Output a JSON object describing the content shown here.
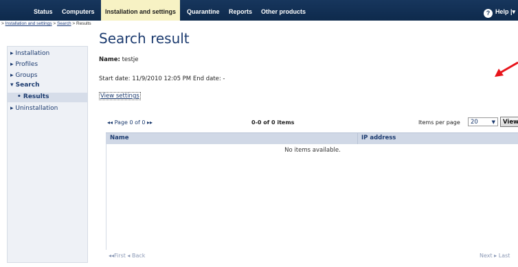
{
  "topnav": {
    "items": [
      {
        "label": "Status"
      },
      {
        "label": "Computers"
      },
      {
        "label": "Installation and settings"
      },
      {
        "label": "Quarantine"
      },
      {
        "label": "Reports"
      },
      {
        "label": "Other products"
      }
    ],
    "help_label": "Help |",
    "help_caret": "▾"
  },
  "breadcrumb": {
    "sep": ">",
    "item1": "Installation and settings",
    "item2": "Search",
    "item3": "Results"
  },
  "sidebar": {
    "items": [
      {
        "label": "▸ Installation"
      },
      {
        "label": "▸ Profiles"
      },
      {
        "label": "▸ Groups"
      },
      {
        "label": "▾ Search"
      },
      {
        "label": "• Results"
      },
      {
        "label": "▸ Uninstallation"
      }
    ]
  },
  "main": {
    "title": "Search result",
    "name_label": "Name:",
    "name_value": "testje",
    "dates": "Start date: 11/9/2010 12:05 PM End date: -",
    "view_settings": "View settings"
  },
  "grid": {
    "pager_text": "◂◂ Page 0 of 0 ▸▸",
    "count_text": "0-0 of 0 items",
    "items_per_page_label": "Items per page",
    "items_per_page_value": "20",
    "view_button": "View",
    "columns": [
      "Name",
      "IP address"
    ],
    "empty_text": "No items available.",
    "footer_first": "◂◂First  ◂ Back",
    "footer_next": "Next ▸  Last"
  },
  "colors": {
    "nav_bg": "#17365d",
    "nav_active_bg": "#f7f2c4",
    "accent_text": "#1c3b6f",
    "annotation_arrow": "#e8141b"
  }
}
